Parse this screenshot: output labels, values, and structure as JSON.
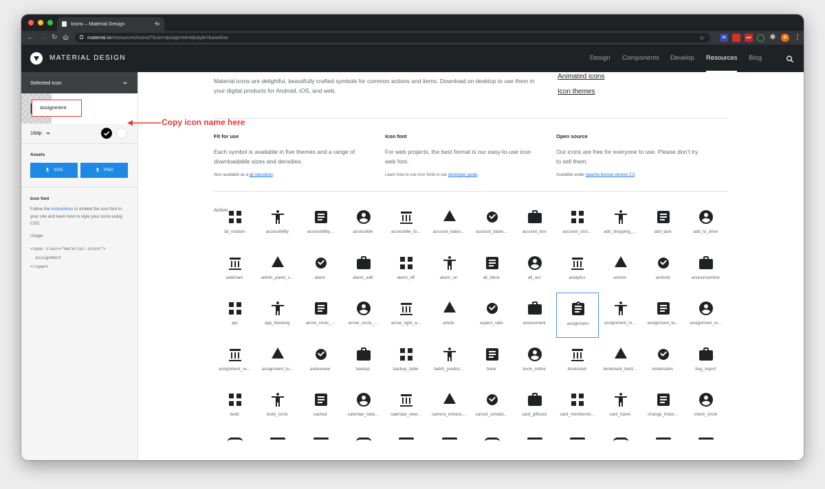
{
  "browser": {
    "tab_title": "Icons – Material Design",
    "tab_close": "×",
    "new_tab": "+",
    "url_host": "material.io",
    "url_path": "/resources/icons/?icon=assignment&style=baseline",
    "ext_badge": "10",
    "ext_abp": "ABP",
    "profile_initial": "D"
  },
  "header": {
    "brand": "MATERIAL DESIGN",
    "nav": [
      "Design",
      "Components",
      "Develop",
      "Resources",
      "Blog"
    ],
    "active_nav": "Resources"
  },
  "sidebar": {
    "selected_icon_label": "Selected Icon",
    "icon_name": "assignment",
    "size": "18dp",
    "assets_label": "Assets",
    "svg_button": "SVG",
    "png_button": "PNG",
    "icon_font_label": "Icon font",
    "icon_font_text_1": "Follow the ",
    "icon_font_link": "instructions",
    "icon_font_text_2": " to embed the icon font in your site and learn how to style your icons using CSS.",
    "usage_label": "Usage:",
    "code_line_1": "<span class=\"material-icons\">",
    "code_line_2": "  assignment",
    "code_line_3": "</span>"
  },
  "annotation": "Copy icon name here",
  "main": {
    "intro": "Material icons are delightful, beautifully crafted symbols for common actions and items. Download on desktop to use them in your digital products for Android, iOS, and web.",
    "links": [
      "Animated icons",
      "Icon themes"
    ],
    "features": [
      {
        "title": "Fit for use",
        "desc": "Each symbol is available in five themes and a range of downloadable sizes and densities.",
        "note_pre": "Also available as a ",
        "note_link": "git repository",
        "note_post": "."
      },
      {
        "title": "Icon font",
        "desc": "For web projects, the best format is our easy-to-use icon web font.",
        "note_pre": "Learn how to use icon fonts in our ",
        "note_link": "developer guide",
        "note_post": "."
      },
      {
        "title": "Open source",
        "desc": "Our icons are free for everyone to use. Please don’t try to sell them.",
        "note_pre": "Available under ",
        "note_link": "Apache license version 2.0",
        "note_post": "."
      }
    ],
    "section": "Action",
    "selected_icon": "assignment",
    "icons": [
      [
        "3d_rotation",
        "accessibility",
        "accessibility...",
        "accessible",
        "accessible_fo...",
        "account_balan...",
        "account_balan...",
        "account_box",
        "account_circl...",
        "add_shopping_...",
        "add_task",
        "add_to_drive"
      ],
      [
        "addchart",
        "admin_panel_s...",
        "alarm",
        "alarm_add",
        "alarm_off",
        "alarm_on",
        "all_inbox",
        "all_out",
        "analytics",
        "anchor",
        "android",
        "announcement"
      ],
      [
        "api",
        "app_blocking",
        "arrow_circle_...",
        "arrow_circle_...",
        "arrow_right_a...",
        "article",
        "aspect_ratio",
        "assessment",
        "assignment",
        "assignment_in...",
        "assignment_la...",
        "assignment_re..."
      ],
      [
        "assignment_re...",
        "assignment_tu...",
        "autorenew",
        "backup",
        "backup_table",
        "batch_predict...",
        "book",
        "book_online",
        "bookmark",
        "bookmark_bord...",
        "bookmarks",
        "bug_report"
      ],
      [
        "build",
        "build_circle",
        "cached",
        "calendar_toda...",
        "calendar_view...",
        "camera_enhanc...",
        "cancel_schedu...",
        "card_giftcard",
        "card_membersh...",
        "card_travel",
        "change_histor...",
        "check_circle"
      ]
    ]
  }
}
